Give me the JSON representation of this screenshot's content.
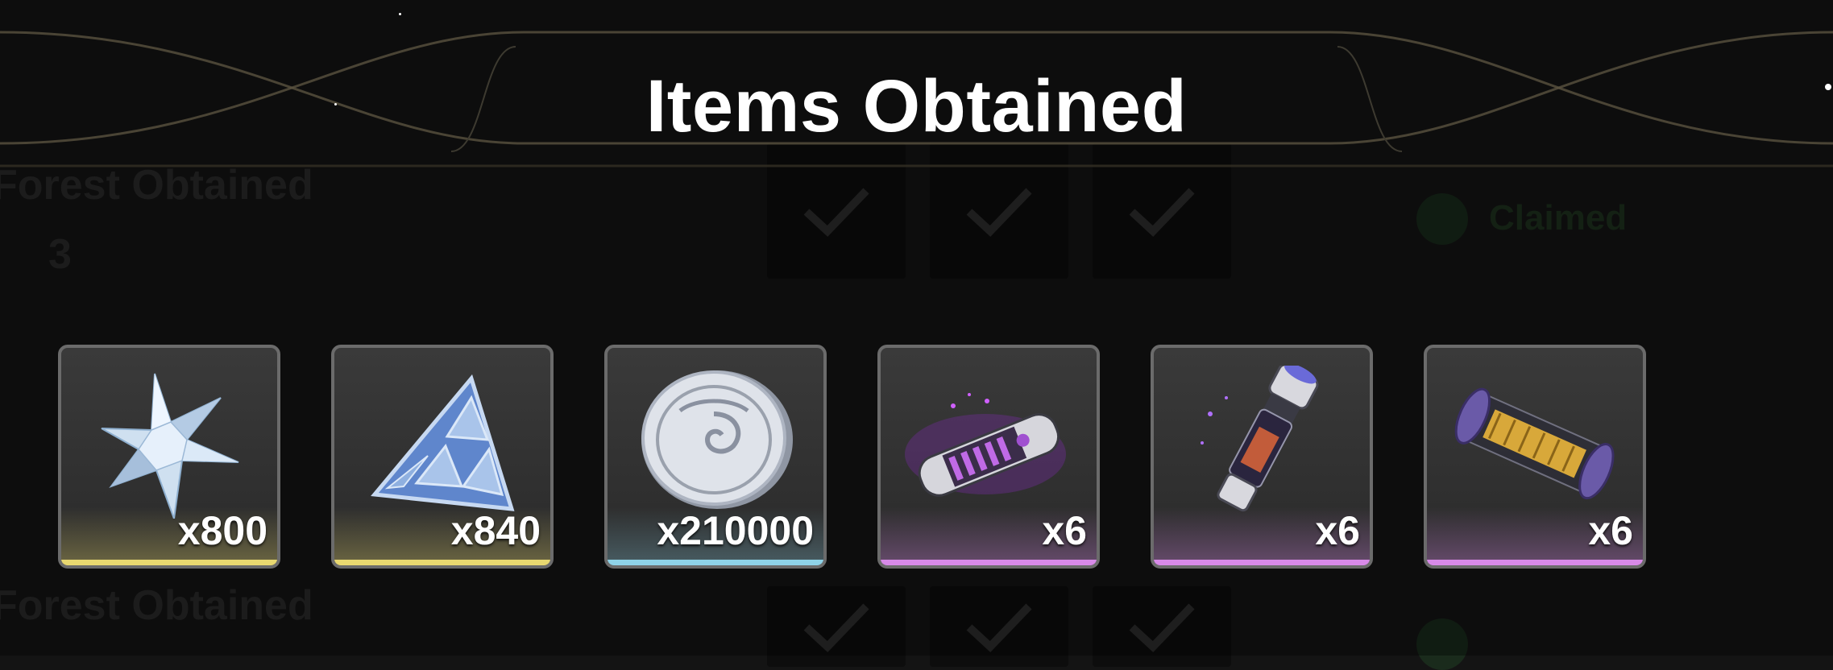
{
  "dialog": {
    "title": "Items Obtained"
  },
  "items": [
    {
      "icon": "star-crystal-icon",
      "quantity": "x800",
      "rarity_color": "#e8d870"
    },
    {
      "icon": "triangle-crystal-icon",
      "quantity": "x840",
      "rarity_color": "#e8d870"
    },
    {
      "icon": "silver-coin-icon",
      "quantity": "x210000",
      "rarity_color": "#8fd3e8"
    },
    {
      "icon": "purple-capsule-icon",
      "quantity": "x6",
      "rarity_color": "#d88ae8"
    },
    {
      "icon": "vial-tube-icon",
      "quantity": "x6",
      "rarity_color": "#d88ae8"
    },
    {
      "icon": "gold-cylinder-icon",
      "quantity": "x6",
      "rarity_color": "#d88ae8"
    }
  ],
  "background": {
    "faint_texts": [
      "Forest Obtained",
      "Forest Obtained"
    ],
    "faint_count": "3",
    "claimed_label": "Claimed"
  }
}
